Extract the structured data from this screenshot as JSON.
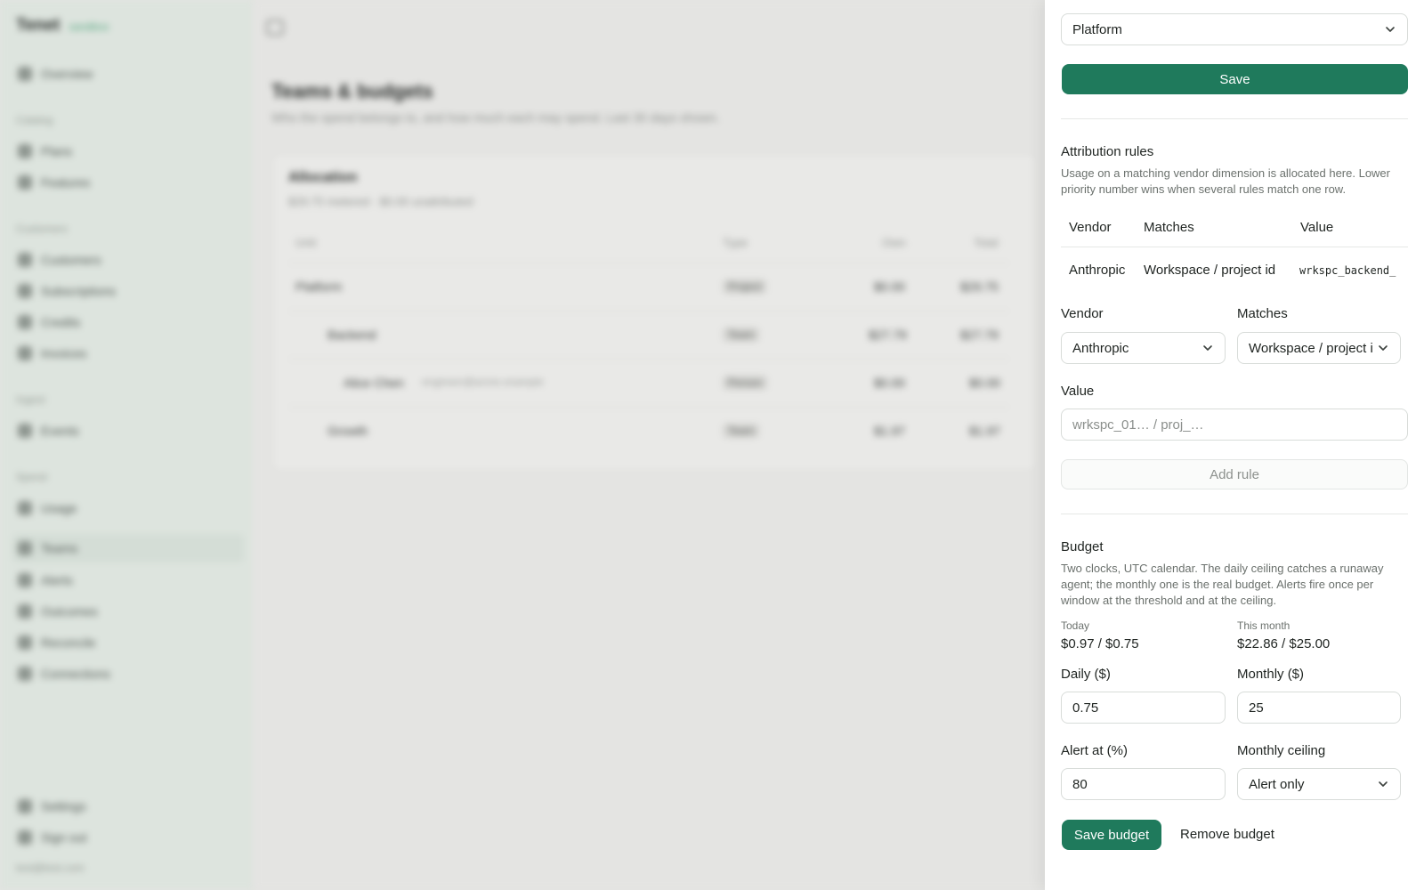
{
  "app": {
    "brand": "Tenet",
    "environment": "sandbox",
    "nav": [
      {
        "label": "Overview",
        "icon": "home-icon"
      },
      {
        "section": "Catalog"
      },
      {
        "label": "Plans",
        "icon": "plans-icon"
      },
      {
        "label": "Features",
        "icon": "features-icon"
      },
      {
        "section": "Customers"
      },
      {
        "label": "Customers",
        "icon": "customers-icon"
      },
      {
        "label": "Subscriptions",
        "icon": "subscriptions-icon"
      },
      {
        "label": "Credits",
        "icon": "credits-icon"
      },
      {
        "label": "Invoices",
        "icon": "invoices-icon"
      },
      {
        "section": "Ingest"
      },
      {
        "label": "Events",
        "icon": "events-icon"
      },
      {
        "section": "Spend"
      },
      {
        "label": "Usage",
        "icon": "usage-icon"
      },
      {
        "label": "Teams",
        "icon": "teams-icon",
        "active": true
      },
      {
        "label": "Alerts",
        "icon": "alerts-icon"
      },
      {
        "label": "Outcomes",
        "icon": "outcomes-icon"
      },
      {
        "label": "Reconcile",
        "icon": "reconcile-icon"
      },
      {
        "label": "Connections",
        "icon": "connections-icon"
      }
    ],
    "footer": {
      "settings": "Settings",
      "sign_out": "Sign out",
      "email": "test@test.com"
    }
  },
  "page": {
    "title": "Teams & budgets",
    "subtitle": "Who the spend belongs to, and how much each may spend. Last 30 days shown.",
    "allocation": {
      "title": "Allocation",
      "subtitle": "$29.75 metered · $0.00 unattributed",
      "columns": [
        "Unit",
        "Type",
        "Own",
        "Total"
      ],
      "rows": [
        {
          "unit": "Platform",
          "email": "",
          "type": "Project",
          "own": "$0.00",
          "total": "$29.75"
        },
        {
          "unit": "Backend",
          "email": "",
          "type": "Team",
          "own": "$27.79",
          "total": "$27.79"
        },
        {
          "unit": "Alice Chen",
          "email": "engineer@acme.example",
          "type": "Person",
          "own": "$0.00",
          "total": "$0.00"
        },
        {
          "unit": "Growth",
          "email": "",
          "type": "Team",
          "own": "$1.97",
          "total": "$1.97"
        }
      ]
    }
  },
  "drawer": {
    "parent_value": "Platform",
    "save_label": "Save",
    "attribution": {
      "title": "Attribution rules",
      "description": "Usage on a matching vendor dimension is allocated here. Lower priority number wins when several rules match one row.",
      "columns": {
        "vendor": "Vendor",
        "matches": "Matches",
        "value": "Value"
      },
      "rows": [
        {
          "vendor": "Anthropic",
          "matches": "Workspace / project id",
          "value": "wrkspc_backend_"
        }
      ],
      "form": {
        "vendor_label": "Vendor",
        "vendor_value": "Anthropic",
        "matches_label": "Matches",
        "matches_value": "Workspace / project id",
        "value_label": "Value",
        "value_placeholder": "wrkspc_01… / proj_…",
        "add_rule": "Add rule"
      }
    },
    "budget": {
      "title": "Budget",
      "description": "Two clocks, UTC calendar. The daily ceiling catches a runaway agent; the monthly one is the real budget. Alerts fire once per window at the threshold and at the ceiling.",
      "today_label": "Today",
      "today_value": "$0.97 / $0.75",
      "month_label": "This month",
      "month_value": "$22.86 / $25.00",
      "daily_label": "Daily ($)",
      "daily_value": "0.75",
      "monthly_label": "Monthly ($)",
      "monthly_value": "25",
      "alert_label": "Alert at (%)",
      "alert_value": "80",
      "ceiling_label": "Monthly ceiling",
      "ceiling_value": "Alert only",
      "save_budget": "Save budget",
      "remove_budget": "Remove budget"
    },
    "colors": {
      "accent": "#1f7a5c",
      "border": "#d8dcd9"
    }
  }
}
